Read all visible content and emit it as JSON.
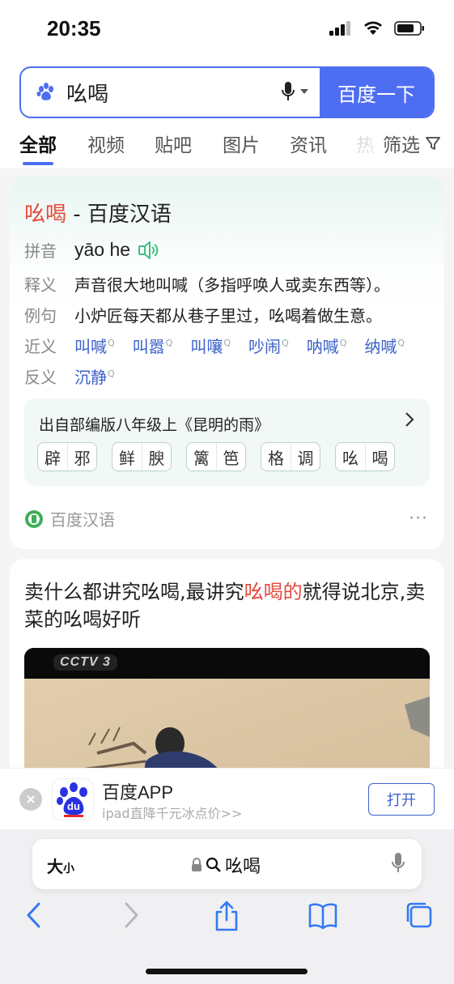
{
  "status": {
    "time": "20:35"
  },
  "search": {
    "query": "吆喝",
    "button_label": "百度一下"
  },
  "tabs": [
    {
      "label": "全部"
    },
    {
      "label": "视频"
    },
    {
      "label": "贴吧"
    },
    {
      "label": "图片"
    },
    {
      "label": "资讯"
    },
    {
      "label": "热"
    }
  ],
  "filter_label": "筛选",
  "dict_card": {
    "title_word": "吆喝",
    "title_suffix": " - 百度汉语",
    "pinyin_label": "拼音",
    "pinyin": "yāo he",
    "meaning_label": "释义",
    "meaning": "声音很大地叫喊（多指呼唤人或卖东西等）。",
    "example_label": "例句",
    "example": "小炉匠每天都从巷子里过，吆喝着做生意。",
    "synonym_label": "近义",
    "synonyms": [
      "叫喊",
      "叫嚣",
      "叫嚷",
      "吵闹",
      "呐喊",
      "纳喊"
    ],
    "antonym_label": "反义",
    "antonyms": [
      "沉静"
    ],
    "source_title": "出自部编版八年级上《昆明的雨》",
    "words": [
      [
        "辟",
        "邪"
      ],
      [
        "鲜",
        "腴"
      ],
      [
        "篱",
        "笆"
      ],
      [
        "格",
        "调"
      ],
      [
        "吆",
        "喝"
      ]
    ],
    "footer_source": "百度汉语",
    "more": "···"
  },
  "video_card": {
    "title_part1": "卖什么都讲究吆喝,最讲究",
    "title_hl": "吆喝的",
    "title_part2": "就得说北京,卖菜的吆喝好听",
    "channel_logo": "CCTV 3"
  },
  "app_banner": {
    "name": "百度APP",
    "subtitle": "ipad直降千元冰点价>>",
    "open_label": "打开",
    "icon_text": "du"
  },
  "safari": {
    "text_size_big": "大",
    "text_size_small": "小",
    "address": "吆喝"
  },
  "colors": {
    "accent": "#4e6ef2",
    "highlight": "#e34c3f",
    "link": "#3c61c9"
  }
}
